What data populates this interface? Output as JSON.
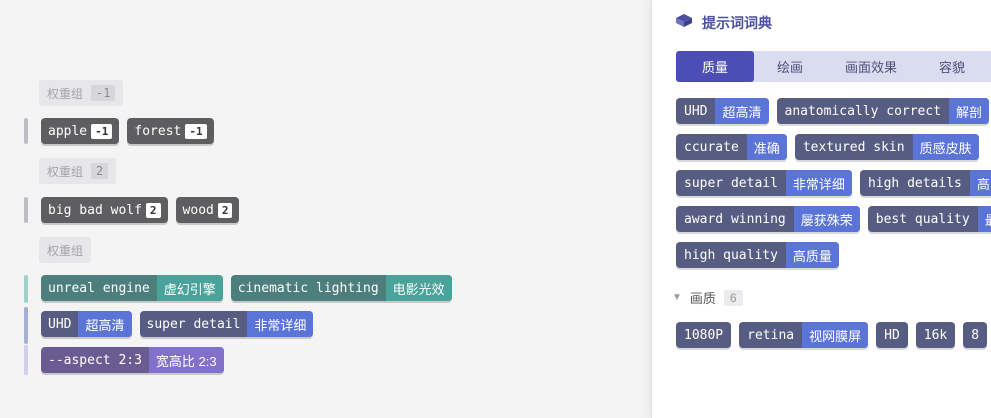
{
  "editor": {
    "groups": [
      {
        "label": "权重组",
        "weight": "-1"
      },
      {
        "label": "权重组",
        "weight": "2"
      },
      {
        "label": "权重组"
      }
    ],
    "row1": [
      {
        "text": "apple",
        "weight": "-1"
      },
      {
        "text": "forest",
        "weight": "-1"
      }
    ],
    "row2": [
      {
        "text": "big bad wolf",
        "weight": "2"
      },
      {
        "text": "wood",
        "weight": "2"
      }
    ],
    "row3": [
      {
        "text": "unreal engine",
        "translation": "虚幻引擎"
      },
      {
        "text": "cinematic lighting",
        "translation": "电影光效"
      }
    ],
    "row4": [
      {
        "text": "UHD",
        "translation": "超高清"
      },
      {
        "text": "super detail",
        "translation": "非常详细"
      }
    ],
    "row5": [
      {
        "text": "--aspect 2:3",
        "translation": "宽高比 2:3"
      }
    ]
  },
  "panel": {
    "title": "提示词词典",
    "tabs": [
      "质量",
      "绘画",
      "画面效果",
      "容貌"
    ],
    "chips": [
      [
        {
          "text": "UHD",
          "translation": "超高清"
        },
        {
          "text": "anatomically correct",
          "translation": "解剖"
        }
      ],
      [
        {
          "text": "ccurate",
          "translation": "准确"
        },
        {
          "text": "textured skin",
          "translation": "质感皮肤"
        }
      ],
      [
        {
          "text": "super detail",
          "translation": "非常详细"
        },
        {
          "text": "high details",
          "translation": "高"
        }
      ],
      [
        {
          "text": "award winning",
          "translation": "屡获殊荣"
        },
        {
          "text": "best quality",
          "translation": "最"
        }
      ],
      [
        {
          "text": "high quality",
          "translation": "高质量"
        }
      ]
    ],
    "section": {
      "label": "画质",
      "count": "6"
    },
    "section_chips": [
      {
        "text": "1080P"
      },
      {
        "text": "retina",
        "translation": "视网膜屏"
      },
      {
        "text": "HD"
      },
      {
        "text": "16k"
      },
      {
        "text": "8"
      }
    ]
  },
  "colors": {
    "accent": "#4c4eb5",
    "teal": "#4aa39a",
    "blue": "#5b74d8",
    "purple": "#8271cc"
  }
}
